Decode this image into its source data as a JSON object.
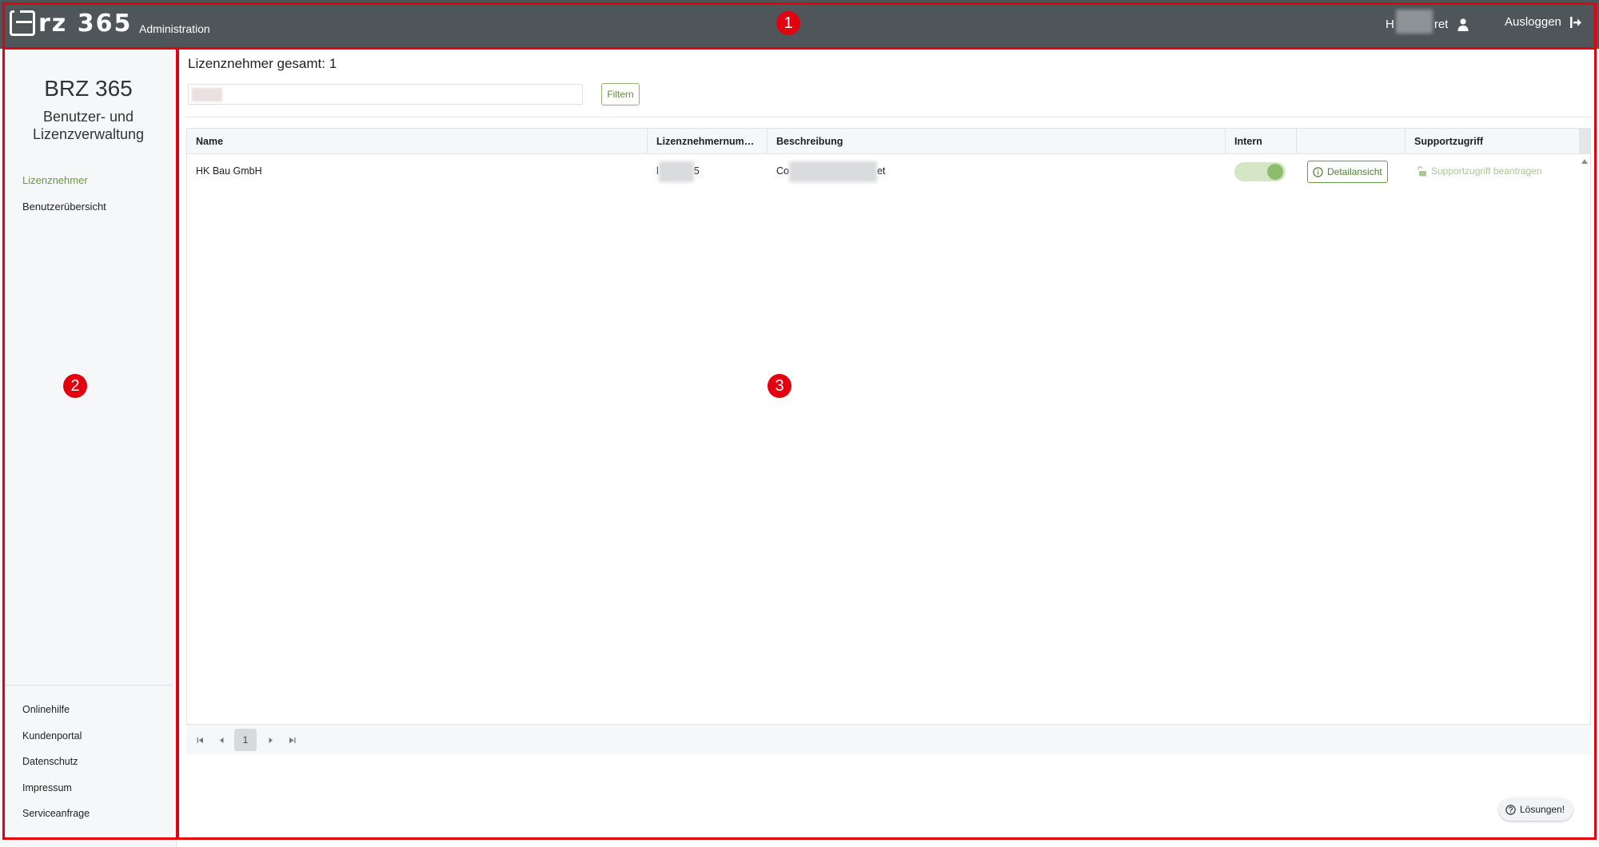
{
  "header": {
    "logo_text": "rz 365",
    "app_name": "Administration",
    "user_prefix": "H",
    "user_suffix": "ret",
    "logout_label": "Ausloggen"
  },
  "sidebar": {
    "title": "BRZ 365",
    "subtitle": "Benutzer- und Lizenzverwaltung",
    "nav": [
      {
        "label": "Lizenznehmer",
        "active": true
      },
      {
        "label": "Benutzerübersicht",
        "active": false
      }
    ],
    "footer": [
      "Onlinehilfe",
      "Kundenportal",
      "Datenschutz",
      "Impressum",
      "Serviceanfrage"
    ]
  },
  "main": {
    "heading": "Lizenznehmer gesamt: 1",
    "filter_label": "Filtern",
    "columns": [
      "Name",
      "Lizenznehmernum…",
      "Beschreibung",
      "Intern",
      "",
      "Supportzugriff"
    ],
    "rows": [
      {
        "name": "HK Bau GmbH",
        "number_prefix": "l",
        "number_suffix": "5",
        "description_prefix": "Co",
        "description_suffix": "et",
        "intern": true,
        "detail_label": "Detailansicht",
        "support_label": "Supportzugriff beantragen"
      }
    ],
    "pager": {
      "current_page": "1"
    },
    "help_label": "Lösungen!"
  },
  "annotations": [
    "1",
    "2",
    "3"
  ],
  "colors": {
    "topbar": "#4f5659",
    "accent_green": "#6b9a46",
    "annotation_red": "#e3000f"
  }
}
